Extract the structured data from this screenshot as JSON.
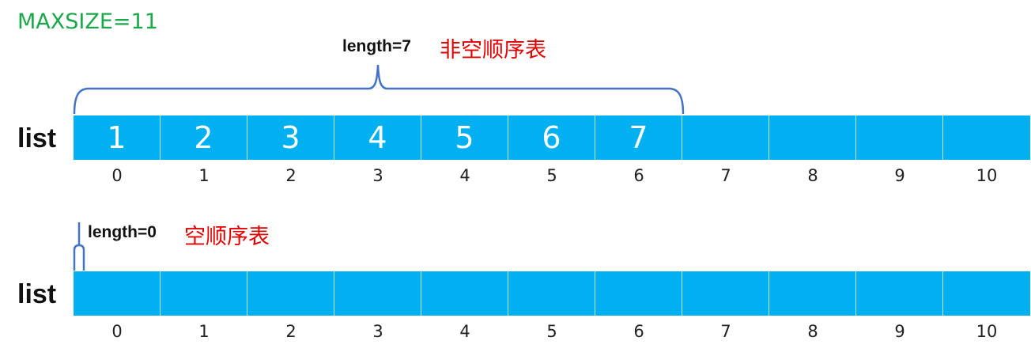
{
  "maxsize_label": "MAXSIZE=11",
  "colors": {
    "cell": "#00b0f0",
    "brace": "#4472c4",
    "maxsize": "#1aa84a",
    "tag": "#e00000"
  },
  "lists": [
    {
      "label": "list",
      "length_label": "length=7",
      "tag": "非空顺序表",
      "values": [
        "1",
        "2",
        "3",
        "4",
        "5",
        "6",
        "7",
        "",
        "",
        "",
        ""
      ],
      "indices": [
        "0",
        "1",
        "2",
        "3",
        "4",
        "5",
        "6",
        "7",
        "8",
        "9",
        "10"
      ]
    },
    {
      "label": "list",
      "length_label": "length=0",
      "tag": "空顺序表",
      "values": [
        "",
        "",
        "",
        "",
        "",
        "",
        "",
        "",
        "",
        "",
        ""
      ],
      "indices": [
        "0",
        "1",
        "2",
        "3",
        "4",
        "5",
        "6",
        "7",
        "8",
        "9",
        "10"
      ]
    }
  ]
}
